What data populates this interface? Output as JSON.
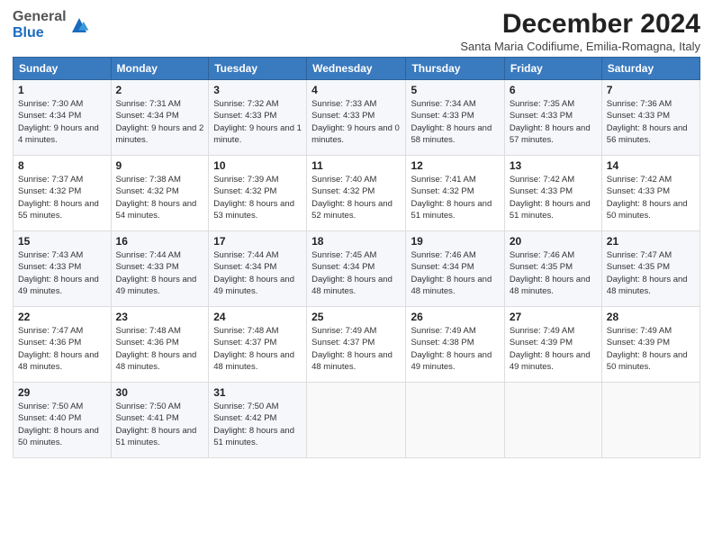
{
  "logo": {
    "general": "General",
    "blue": "Blue"
  },
  "title": "December 2024",
  "subtitle": "Santa Maria Codifiume, Emilia-Romagna, Italy",
  "days_of_week": [
    "Sunday",
    "Monday",
    "Tuesday",
    "Wednesday",
    "Thursday",
    "Friday",
    "Saturday"
  ],
  "weeks": [
    [
      {
        "day": "1",
        "sunrise": "Sunrise: 7:30 AM",
        "sunset": "Sunset: 4:34 PM",
        "daylight": "Daylight: 9 hours and 4 minutes."
      },
      {
        "day": "2",
        "sunrise": "Sunrise: 7:31 AM",
        "sunset": "Sunset: 4:34 PM",
        "daylight": "Daylight: 9 hours and 2 minutes."
      },
      {
        "day": "3",
        "sunrise": "Sunrise: 7:32 AM",
        "sunset": "Sunset: 4:33 PM",
        "daylight": "Daylight: 9 hours and 1 minute."
      },
      {
        "day": "4",
        "sunrise": "Sunrise: 7:33 AM",
        "sunset": "Sunset: 4:33 PM",
        "daylight": "Daylight: 9 hours and 0 minutes."
      },
      {
        "day": "5",
        "sunrise": "Sunrise: 7:34 AM",
        "sunset": "Sunset: 4:33 PM",
        "daylight": "Daylight: 8 hours and 58 minutes."
      },
      {
        "day": "6",
        "sunrise": "Sunrise: 7:35 AM",
        "sunset": "Sunset: 4:33 PM",
        "daylight": "Daylight: 8 hours and 57 minutes."
      },
      {
        "day": "7",
        "sunrise": "Sunrise: 7:36 AM",
        "sunset": "Sunset: 4:33 PM",
        "daylight": "Daylight: 8 hours and 56 minutes."
      }
    ],
    [
      {
        "day": "8",
        "sunrise": "Sunrise: 7:37 AM",
        "sunset": "Sunset: 4:32 PM",
        "daylight": "Daylight: 8 hours and 55 minutes."
      },
      {
        "day": "9",
        "sunrise": "Sunrise: 7:38 AM",
        "sunset": "Sunset: 4:32 PM",
        "daylight": "Daylight: 8 hours and 54 minutes."
      },
      {
        "day": "10",
        "sunrise": "Sunrise: 7:39 AM",
        "sunset": "Sunset: 4:32 PM",
        "daylight": "Daylight: 8 hours and 53 minutes."
      },
      {
        "day": "11",
        "sunrise": "Sunrise: 7:40 AM",
        "sunset": "Sunset: 4:32 PM",
        "daylight": "Daylight: 8 hours and 52 minutes."
      },
      {
        "day": "12",
        "sunrise": "Sunrise: 7:41 AM",
        "sunset": "Sunset: 4:32 PM",
        "daylight": "Daylight: 8 hours and 51 minutes."
      },
      {
        "day": "13",
        "sunrise": "Sunrise: 7:42 AM",
        "sunset": "Sunset: 4:33 PM",
        "daylight": "Daylight: 8 hours and 51 minutes."
      },
      {
        "day": "14",
        "sunrise": "Sunrise: 7:42 AM",
        "sunset": "Sunset: 4:33 PM",
        "daylight": "Daylight: 8 hours and 50 minutes."
      }
    ],
    [
      {
        "day": "15",
        "sunrise": "Sunrise: 7:43 AM",
        "sunset": "Sunset: 4:33 PM",
        "daylight": "Daylight: 8 hours and 49 minutes."
      },
      {
        "day": "16",
        "sunrise": "Sunrise: 7:44 AM",
        "sunset": "Sunset: 4:33 PM",
        "daylight": "Daylight: 8 hours and 49 minutes."
      },
      {
        "day": "17",
        "sunrise": "Sunrise: 7:44 AM",
        "sunset": "Sunset: 4:34 PM",
        "daylight": "Daylight: 8 hours and 49 minutes."
      },
      {
        "day": "18",
        "sunrise": "Sunrise: 7:45 AM",
        "sunset": "Sunset: 4:34 PM",
        "daylight": "Daylight: 8 hours and 48 minutes."
      },
      {
        "day": "19",
        "sunrise": "Sunrise: 7:46 AM",
        "sunset": "Sunset: 4:34 PM",
        "daylight": "Daylight: 8 hours and 48 minutes."
      },
      {
        "day": "20",
        "sunrise": "Sunrise: 7:46 AM",
        "sunset": "Sunset: 4:35 PM",
        "daylight": "Daylight: 8 hours and 48 minutes."
      },
      {
        "day": "21",
        "sunrise": "Sunrise: 7:47 AM",
        "sunset": "Sunset: 4:35 PM",
        "daylight": "Daylight: 8 hours and 48 minutes."
      }
    ],
    [
      {
        "day": "22",
        "sunrise": "Sunrise: 7:47 AM",
        "sunset": "Sunset: 4:36 PM",
        "daylight": "Daylight: 8 hours and 48 minutes."
      },
      {
        "day": "23",
        "sunrise": "Sunrise: 7:48 AM",
        "sunset": "Sunset: 4:36 PM",
        "daylight": "Daylight: 8 hours and 48 minutes."
      },
      {
        "day": "24",
        "sunrise": "Sunrise: 7:48 AM",
        "sunset": "Sunset: 4:37 PM",
        "daylight": "Daylight: 8 hours and 48 minutes."
      },
      {
        "day": "25",
        "sunrise": "Sunrise: 7:49 AM",
        "sunset": "Sunset: 4:37 PM",
        "daylight": "Daylight: 8 hours and 48 minutes."
      },
      {
        "day": "26",
        "sunrise": "Sunrise: 7:49 AM",
        "sunset": "Sunset: 4:38 PM",
        "daylight": "Daylight: 8 hours and 49 minutes."
      },
      {
        "day": "27",
        "sunrise": "Sunrise: 7:49 AM",
        "sunset": "Sunset: 4:39 PM",
        "daylight": "Daylight: 8 hours and 49 minutes."
      },
      {
        "day": "28",
        "sunrise": "Sunrise: 7:49 AM",
        "sunset": "Sunset: 4:39 PM",
        "daylight": "Daylight: 8 hours and 50 minutes."
      }
    ],
    [
      {
        "day": "29",
        "sunrise": "Sunrise: 7:50 AM",
        "sunset": "Sunset: 4:40 PM",
        "daylight": "Daylight: 8 hours and 50 minutes."
      },
      {
        "day": "30",
        "sunrise": "Sunrise: 7:50 AM",
        "sunset": "Sunset: 4:41 PM",
        "daylight": "Daylight: 8 hours and 51 minutes."
      },
      {
        "day": "31",
        "sunrise": "Sunrise: 7:50 AM",
        "sunset": "Sunset: 4:42 PM",
        "daylight": "Daylight: 8 hours and 51 minutes."
      },
      null,
      null,
      null,
      null
    ]
  ]
}
